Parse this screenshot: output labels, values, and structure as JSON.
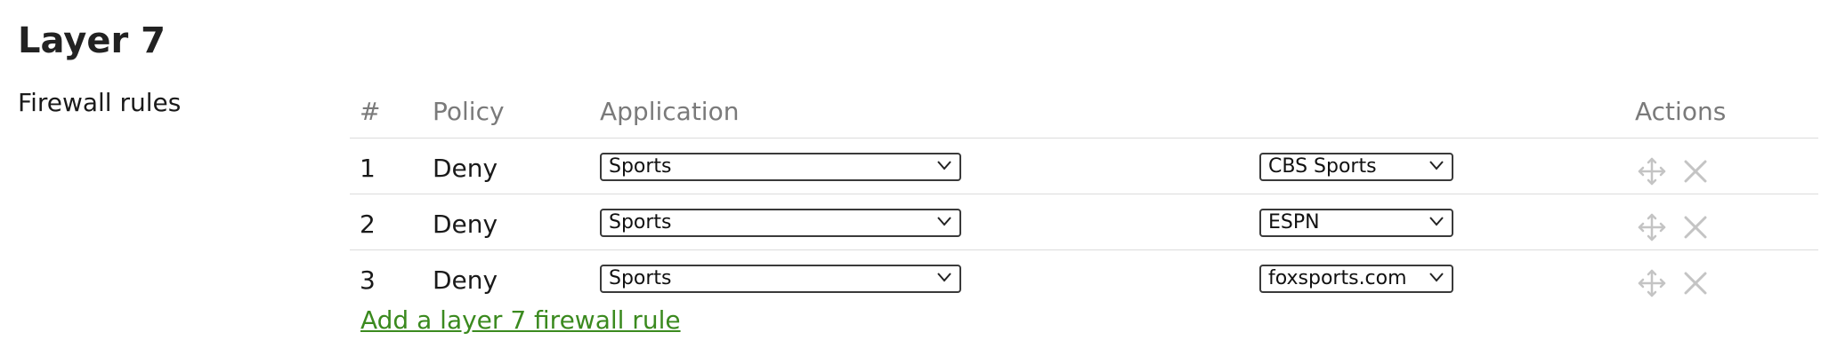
{
  "section": {
    "title": "Layer 7",
    "field_label": "Firewall rules"
  },
  "table": {
    "headers": {
      "number": "#",
      "policy": "Policy",
      "application": "Application",
      "actions": "Actions"
    },
    "rows": [
      {
        "number": "1",
        "policy": "Deny",
        "category": "Sports",
        "application": "CBS Sports"
      },
      {
        "number": "2",
        "policy": "Deny",
        "category": "Sports",
        "application": "ESPN"
      },
      {
        "number": "3",
        "policy": "Deny",
        "category": "Sports",
        "application": "foxsports.com"
      }
    ]
  },
  "add_rule_label": "Add a layer 7 firewall rule",
  "icons": {
    "move": "move-icon",
    "delete": "close-icon",
    "dropdown": "chevron-down-icon"
  },
  "colors": {
    "link": "#3b8a1f",
    "header_text": "#7a7a7a",
    "action_icon": "#c4c4c4",
    "divider": "#dcdcdc"
  }
}
